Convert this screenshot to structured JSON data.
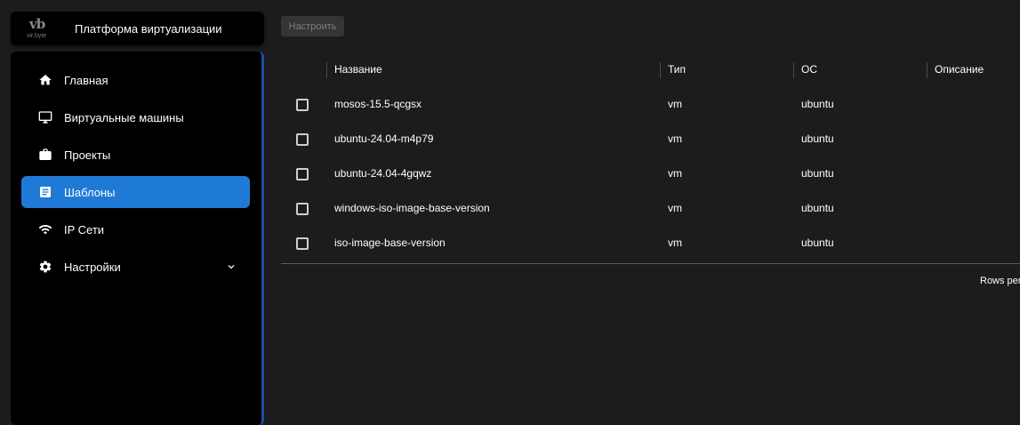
{
  "brand": {
    "logo_mark": "vb",
    "logo_text": "vir.byte",
    "title": "Платформа виртуализации"
  },
  "sidebar": {
    "items": [
      {
        "label": "Главная",
        "icon": "home-icon",
        "active": false
      },
      {
        "label": "Виртуальные машины",
        "icon": "monitor-icon",
        "active": false
      },
      {
        "label": "Проекты",
        "icon": "briefcase-icon",
        "active": false
      },
      {
        "label": "Шаблоны",
        "icon": "document-icon",
        "active": true
      },
      {
        "label": "IP Сети",
        "icon": "wifi-icon",
        "active": false
      },
      {
        "label": "Настройки",
        "icon": "gear-icon",
        "active": false,
        "expandable": true
      }
    ]
  },
  "toolbar": {
    "configure_label": "Настроить"
  },
  "table": {
    "columns": [
      "Название",
      "Тип",
      "ОС",
      "Описание"
    ],
    "rows": [
      {
        "name": "mosos-15.5-qcgsx",
        "type": "vm",
        "os": "ubuntu",
        "description": ""
      },
      {
        "name": "ubuntu-24.04-m4p79",
        "type": "vm",
        "os": "ubuntu",
        "description": ""
      },
      {
        "name": "ubuntu-24.04-4gqwz",
        "type": "vm",
        "os": "ubuntu",
        "description": ""
      },
      {
        "name": "windows-iso-image-base-version",
        "type": "vm",
        "os": "ubuntu",
        "description": ""
      },
      {
        "name": "iso-image-base-version",
        "type": "vm",
        "os": "ubuntu",
        "description": ""
      }
    ],
    "rows_per_page_label": "Rows per"
  },
  "colors": {
    "accent": "#1f7ad6",
    "background": "#1c1c1c",
    "sidebar": "#000000"
  }
}
